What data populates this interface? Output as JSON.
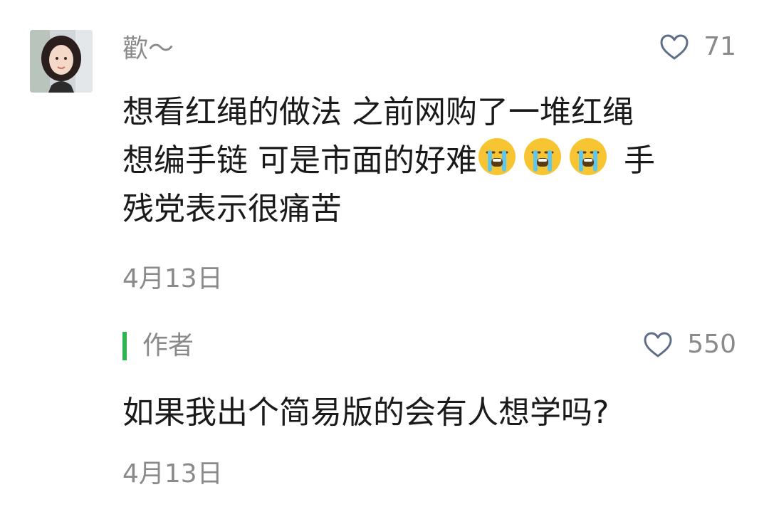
{
  "comment_1": {
    "username": "歡～",
    "likes": "71",
    "text_line_1": "想看红绳的做法 之前网购了一堆红绳",
    "text_line_2_prefix": "想编手链 可是市面的好难",
    "emoji": "loudly-crying-face",
    "emoji_count": 3,
    "text_line_2_suffix": " 手",
    "text_line_3": "残党表示很痛苦",
    "date": "4月13日"
  },
  "reply": {
    "author_label": "作者",
    "likes": "550",
    "text": "如果我出个简易版的会有人想学吗?",
    "date": "4月13日"
  },
  "colors": {
    "text": "#1a1a1a",
    "meta": "#8a8a8a",
    "author_bar": "#2fb54f",
    "heart_outline": "#5e6f87"
  }
}
